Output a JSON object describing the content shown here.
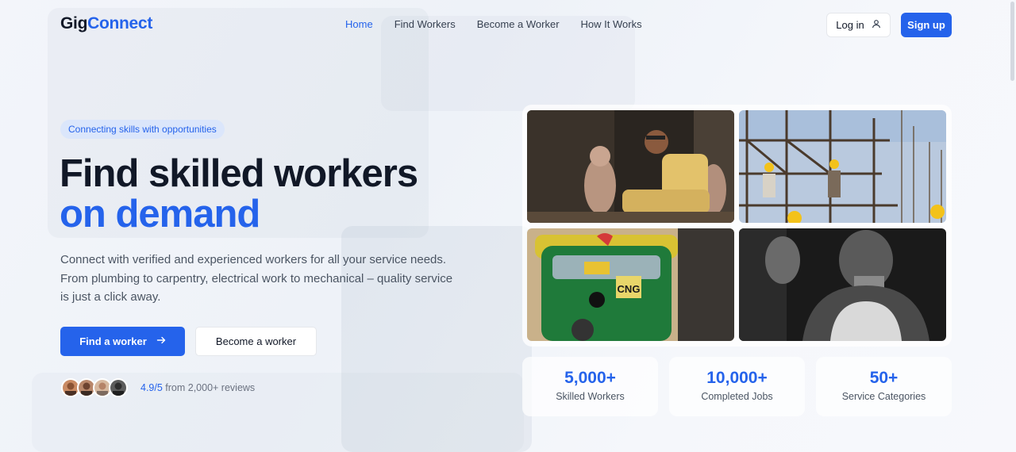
{
  "brand": {
    "part1": "Gig",
    "part2": "Connect",
    "accent_color": "#2563eb"
  },
  "nav": {
    "items": [
      {
        "label": "Home",
        "active": true
      },
      {
        "label": "Find Workers",
        "active": false
      },
      {
        "label": "Become a Worker",
        "active": false
      },
      {
        "label": "How It Works",
        "active": false
      }
    ],
    "login_label": "Log in",
    "login_icon": "user-icon",
    "signup_label": "Sign up"
  },
  "hero": {
    "badge": "Connecting skills with opportunities",
    "title_line1": "Find skilled workers",
    "title_line2": "on demand",
    "description": "Connect with verified and experienced workers for all your service needs. From plumbing to carpentry, electrical work to mechanical – quality service is just a click away.",
    "primary_button": "Find a worker",
    "primary_button_icon": "arrow-right-icon",
    "secondary_button": "Become a worker",
    "rating": "4.9/5",
    "reviews_text": " from 2,000+ reviews"
  },
  "gallery": {
    "images": [
      {
        "name": "artisan-sculpting-photo"
      },
      {
        "name": "construction-scaffolding-photo"
      },
      {
        "name": "auto-rickshaw-driver-photo",
        "plate_text": "CNG"
      },
      {
        "name": "laborer-portrait-photo"
      }
    ]
  },
  "stats": [
    {
      "value": "5,000+",
      "label": "Skilled Workers"
    },
    {
      "value": "10,000+",
      "label": "Completed Jobs"
    },
    {
      "value": "50+",
      "label": "Service Categories"
    }
  ]
}
